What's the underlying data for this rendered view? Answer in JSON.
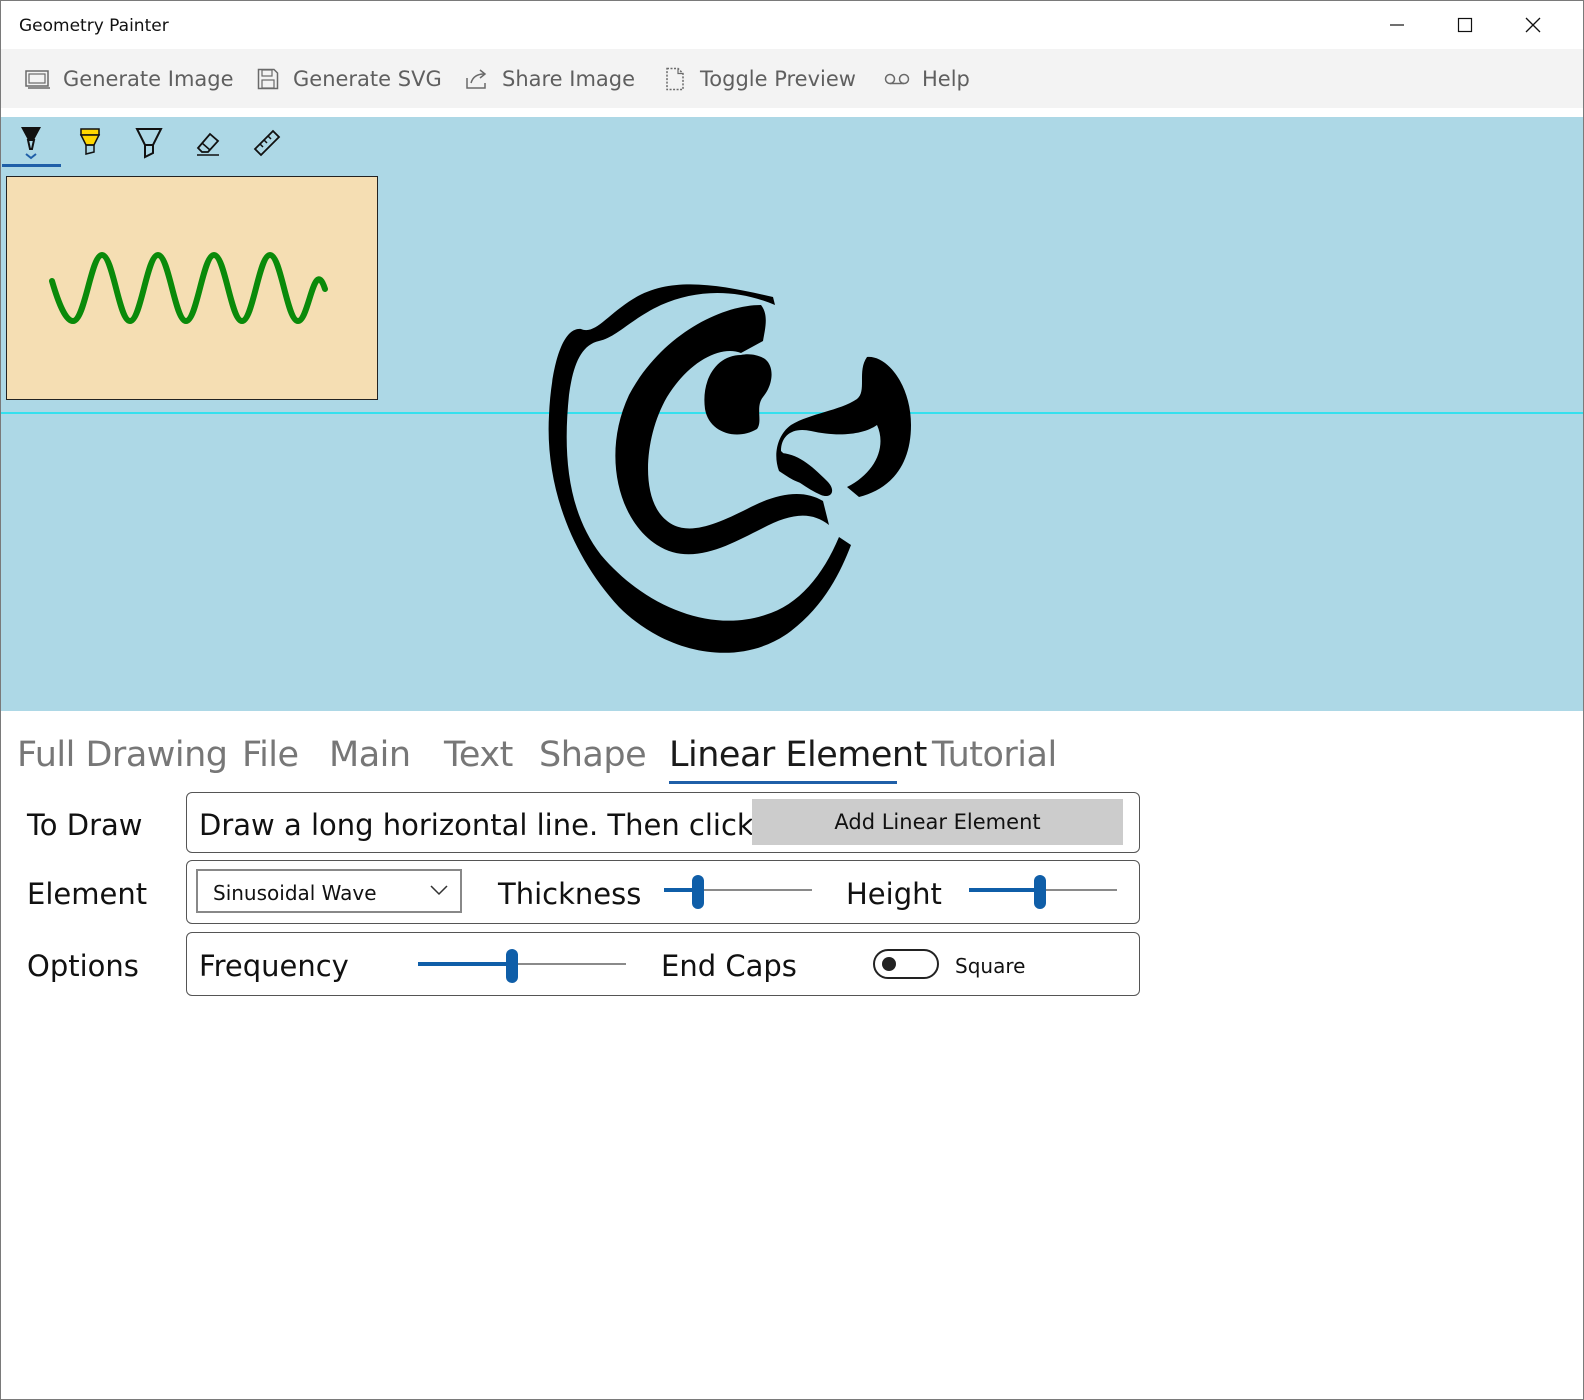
{
  "app": {
    "title": "Geometry Painter"
  },
  "window_controls": {
    "minimize_icon": "minimize-icon",
    "maximize_icon": "maximize-icon",
    "close_icon": "close-icon"
  },
  "commands": [
    {
      "label": "Generate Image",
      "icon": "image-icon"
    },
    {
      "label": "Generate SVG",
      "icon": "save-icon"
    },
    {
      "label": "Share Image",
      "icon": "share-icon"
    },
    {
      "label": "Toggle Preview",
      "icon": "document-icon"
    },
    {
      "label": "Help",
      "icon": "voicemail-icon"
    }
  ],
  "ink_toolbar": {
    "tools": [
      "ballpoint-pen",
      "highlighter",
      "pencil",
      "eraser",
      "ruler"
    ],
    "selected": "ballpoint-pen",
    "highlighter_color": "#ffd700"
  },
  "canvas": {
    "background": "#add8e6",
    "preview_background": "#f5deb3",
    "wave_color": "#0a8a0a",
    "guide_color": "#35e0ee"
  },
  "tabs": [
    "Full Drawing",
    "File",
    "Main",
    "Text",
    "Shape",
    "Linear Element",
    "Tutorial"
  ],
  "active_tab": "Linear Element",
  "to_draw": {
    "label": "To Draw",
    "instruction": "Draw a long horizontal line. Then click :",
    "button": "Add Linear Element"
  },
  "element": {
    "label": "Element",
    "selected": "Sinusoidal Wave",
    "thickness_label": "Thickness",
    "thickness_level": 0.23,
    "height_label": "Height",
    "height_level": 0.48
  },
  "options": {
    "label": "Options",
    "frequency_label": "Frequency",
    "frequency_level": 0.45,
    "end_caps_label": "End Caps",
    "end_caps_on": false,
    "end_caps_value": "Square"
  }
}
